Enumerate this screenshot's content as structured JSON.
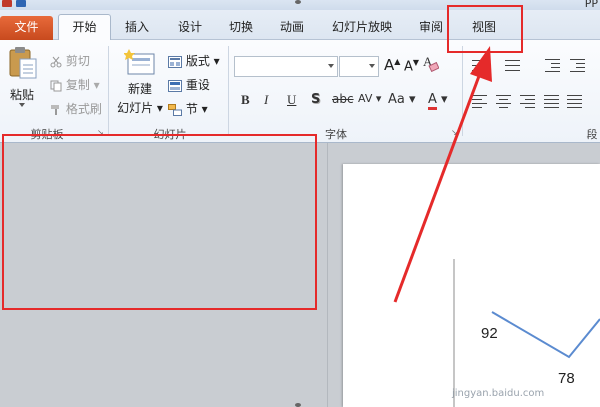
{
  "window": {
    "title_fragment": "PP"
  },
  "tabs": {
    "file": "文件",
    "home": "开始",
    "insert": "插入",
    "design": "设计",
    "transitions": "切换",
    "animations": "动画",
    "slideshow": "幻灯片放映",
    "review": "审阅",
    "view": "视图"
  },
  "ribbon": {
    "clipboard": {
      "label": "剪贴板",
      "paste": "粘贴",
      "cut": "剪切",
      "copy": "复制",
      "format_painter": "格式刷"
    },
    "slides": {
      "label": "幻灯片",
      "new_slide_line1": "新建",
      "new_slide_line2": "幻灯片",
      "layout": "版式",
      "reset": "重设",
      "section": "节"
    },
    "font": {
      "label": "字体",
      "bold": "B",
      "italic": "I",
      "underline": "U",
      "shadow": "S",
      "strikethrough": "abc",
      "spacing": "AV",
      "change_case": "Aa",
      "font_color": "A",
      "grow": "A",
      "shrink": "A"
    },
    "paragraph": {
      "label": "段"
    }
  },
  "chart_data": {
    "type": "line",
    "data_labels": [
      "92",
      "78"
    ],
    "values": [
      92,
      78
    ]
  },
  "watermark": "jingyan.baidu.com",
  "colors": {
    "highlight": "#e52a2a",
    "file_tab": "#d2572a",
    "series": "#5b8bd0"
  }
}
